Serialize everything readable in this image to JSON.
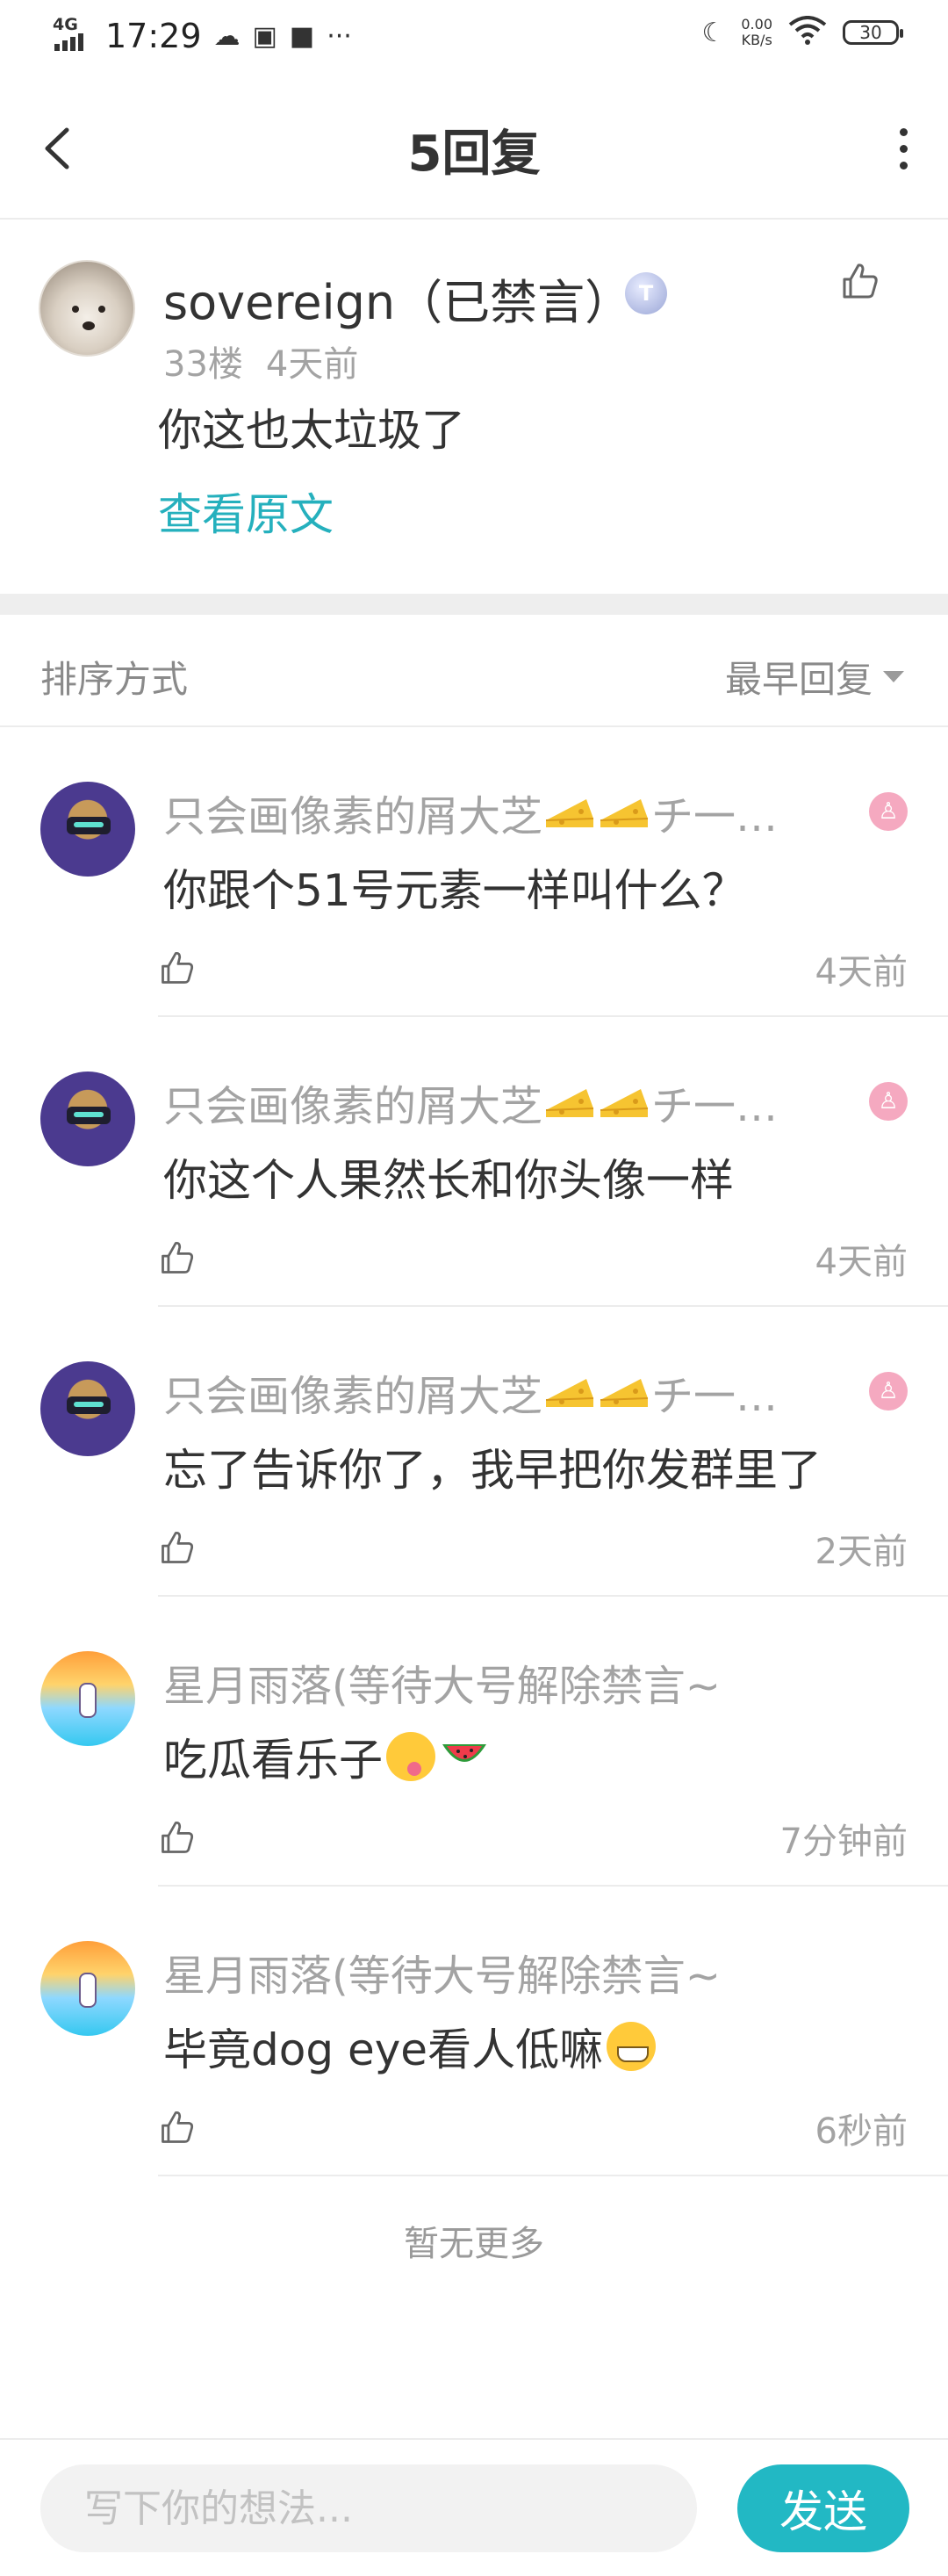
{
  "status_bar": {
    "network": "4G",
    "time": "17:29",
    "speed_value": "0.00",
    "speed_unit": "KB/s",
    "battery": "30"
  },
  "header": {
    "title": "5回复"
  },
  "original_comment": {
    "username": "sovereign（已禁言）",
    "level_badge": "T",
    "floor": "33楼",
    "time": "4天前",
    "text": "你这也太垃圾了",
    "view_original": "查看原文"
  },
  "sort": {
    "label": "排序方式",
    "value": "最早回复"
  },
  "replies": [
    {
      "name": "只会画像素的屑大芝",
      "name_suffix": "チ一…",
      "cheese_count": 2,
      "text": "你跟个51号元素一样叫什么？",
      "time": "4天前",
      "avatar": "pixel",
      "badge": "pink-badge"
    },
    {
      "name": "只会画像素的屑大芝",
      "name_suffix": "チ一…",
      "cheese_count": 2,
      "text": "你这个人果然长和你头像一样",
      "time": "4天前",
      "avatar": "pixel",
      "badge": "pink-badge"
    },
    {
      "name": "只会画像素的屑大芝",
      "name_suffix": "チ一…",
      "cheese_count": 2,
      "text": "忘了告诉你了，我早把你发群里了",
      "time": "2天前",
      "avatar": "pixel",
      "badge": "pink-badge"
    },
    {
      "name": "星月雨落(等待大号解除禁言~",
      "text": "吃瓜看乐子",
      "emoji": [
        "yum-emoji",
        "watermelon-emoji"
      ],
      "time": "7分钟前",
      "avatar": "sky"
    },
    {
      "name": "星月雨落(等待大号解除禁言~",
      "text": "毕竟dog eye看人低嘛",
      "emoji": [
        "grin-emoji"
      ],
      "time": "6秒前",
      "avatar": "sky"
    }
  ],
  "footer_note": "暂无更多",
  "composer": {
    "placeholder": "写下你的想法...",
    "send_label": "发送"
  },
  "colors": {
    "accent": "#22b8c4",
    "link": "#25b0bd",
    "muted": "#a3a3a3"
  }
}
